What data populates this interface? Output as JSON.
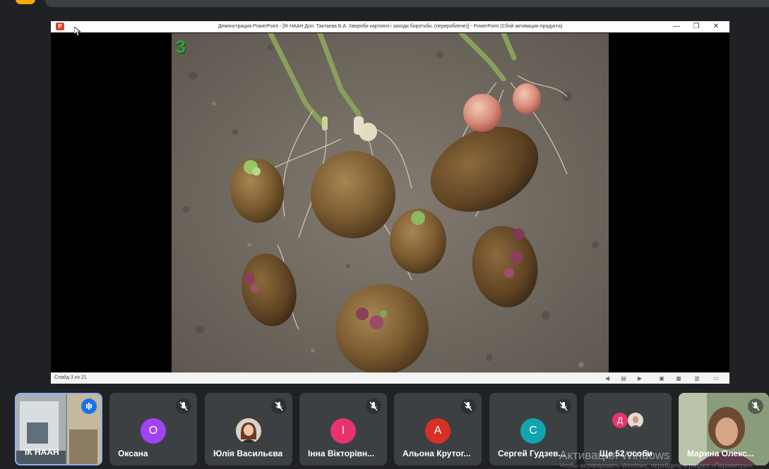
{
  "window": {
    "title": "Демонстрация PowerPoint - [ІК НААН Доп. Тактаєва Б.А. Хвороби картоплі і заходи боротьби. (перероблене)] - PowerPoint (Сбой активации продукта)",
    "app_icon": "powerpoint-icon",
    "logo_letter": "P",
    "minimize": "—",
    "restore": "❐",
    "close": "✕"
  },
  "slide": {
    "number": "3",
    "image_subject": "potato-tubers-photo"
  },
  "statusbar": {
    "slide_info": "Слайд 3 из 21"
  },
  "participants": [
    {
      "name": "ІК НААН",
      "type": "video",
      "speaking": true
    },
    {
      "name": "Оксана",
      "initial": "О",
      "color": "#a142f4",
      "muted": true
    },
    {
      "name": "Юлія Васильєва",
      "type": "photo",
      "muted": true
    },
    {
      "name": "Інна Вікторівн...",
      "initial": "І",
      "color": "#e8336d",
      "muted": true
    },
    {
      "name": "Альона Крутог...",
      "initial": "А",
      "color": "#d93025",
      "muted": true
    },
    {
      "name": "Сергей Гудзев...",
      "initial": "С",
      "color": "#12a4af",
      "muted": true
    },
    {
      "name": "Ще 52 особи",
      "initial": "Д",
      "color": "#e8336d",
      "type": "more"
    },
    {
      "name": "Марина Олекс...",
      "type": "video",
      "muted": true
    }
  ],
  "watermark": {
    "line1": "Активация Windows",
    "line2": "Чтобы активировать Windows, перейдите в раздел «Параметры»"
  },
  "colors": {
    "background": "#202124",
    "tile": "#3c4043",
    "accent": "#1a73e8",
    "slide_number": "#2ca63a"
  }
}
